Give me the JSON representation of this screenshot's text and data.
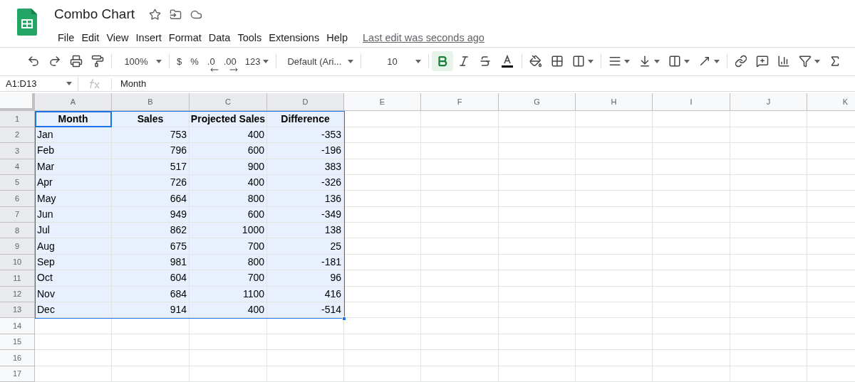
{
  "document": {
    "title": "Combo Chart",
    "menu": [
      "File",
      "Edit",
      "View",
      "Insert",
      "Format",
      "Data",
      "Tools",
      "Extensions",
      "Help"
    ],
    "last_edit": "Last edit was seconds ago"
  },
  "toolbar": {
    "zoom": "100%",
    "currency": "$",
    "percent": "%",
    "decrease_decimals": ".0",
    "increase_decimals": ".00",
    "number_format": "123",
    "font": "Default (Ari...",
    "font_size": "10",
    "bold_active": true
  },
  "formula_bar": {
    "name_box": "A1:D13",
    "value": "Month"
  },
  "columns": [
    {
      "label": "A",
      "selected": true
    },
    {
      "label": "B",
      "selected": true
    },
    {
      "label": "C",
      "selected": true
    },
    {
      "label": "D",
      "selected": true
    },
    {
      "label": "E",
      "selected": false
    },
    {
      "label": "F",
      "selected": false
    },
    {
      "label": "G",
      "selected": false
    },
    {
      "label": "H",
      "selected": false
    },
    {
      "label": "I",
      "selected": false
    },
    {
      "label": "J",
      "selected": false
    },
    {
      "label": "K",
      "selected": false
    }
  ],
  "rows": [
    {
      "number": "1",
      "selected": true,
      "active": true,
      "bold": true,
      "cells": [
        "Month",
        "Sales",
        "Projected Sales",
        "Difference"
      ]
    },
    {
      "number": "2",
      "selected": true,
      "active": false,
      "bold": false,
      "cells": [
        "Jan",
        "753",
        "400",
        "-353"
      ]
    },
    {
      "number": "3",
      "selected": true,
      "active": false,
      "bold": false,
      "cells": [
        "Feb",
        "796",
        "600",
        "-196"
      ]
    },
    {
      "number": "4",
      "selected": true,
      "active": false,
      "bold": false,
      "cells": [
        "Mar",
        "517",
        "900",
        "383"
      ]
    },
    {
      "number": "5",
      "selected": true,
      "active": false,
      "bold": false,
      "cells": [
        "Apr",
        "726",
        "400",
        "-326"
      ]
    },
    {
      "number": "6",
      "selected": true,
      "active": false,
      "bold": false,
      "cells": [
        "May",
        "664",
        "800",
        "136"
      ]
    },
    {
      "number": "7",
      "selected": true,
      "active": false,
      "bold": false,
      "cells": [
        "Jun",
        "949",
        "600",
        "-349"
      ]
    },
    {
      "number": "8",
      "selected": true,
      "active": false,
      "bold": false,
      "cells": [
        "Jul",
        "862",
        "1000",
        "138"
      ]
    },
    {
      "number": "9",
      "selected": true,
      "active": false,
      "bold": false,
      "cells": [
        "Aug",
        "675",
        "700",
        "25"
      ]
    },
    {
      "number": "10",
      "selected": true,
      "active": false,
      "bold": false,
      "cells": [
        "Sep",
        "981",
        "800",
        "-181"
      ]
    },
    {
      "number": "11",
      "selected": true,
      "active": false,
      "bold": false,
      "cells": [
        "Oct",
        "604",
        "700",
        "96"
      ]
    },
    {
      "number": "12",
      "selected": true,
      "active": false,
      "bold": false,
      "cells": [
        "Nov",
        "684",
        "1100",
        "416"
      ]
    },
    {
      "number": "13",
      "selected": true,
      "active": false,
      "bold": false,
      "cells": [
        "Dec",
        "914",
        "400",
        "-514"
      ]
    },
    {
      "number": "14",
      "selected": false
    },
    {
      "number": "15",
      "selected": false
    },
    {
      "number": "16",
      "selected": false
    },
    {
      "number": "17",
      "selected": false
    }
  ]
}
